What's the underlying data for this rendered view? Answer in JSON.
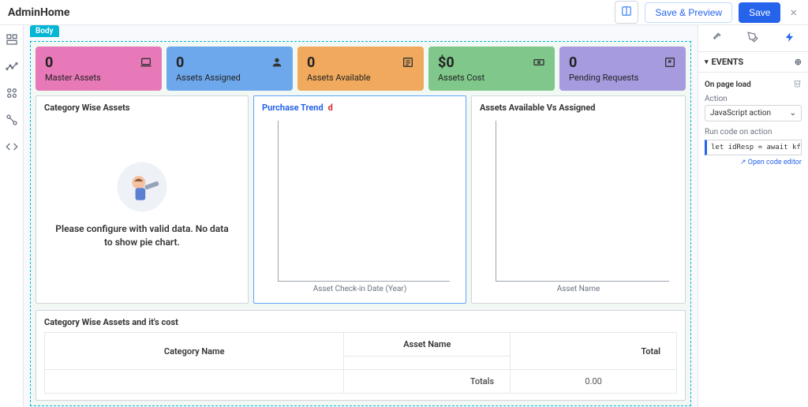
{
  "header": {
    "title": "AdminHome",
    "save_preview": "Save & Preview",
    "save": "Save"
  },
  "canvas": {
    "body_tag": "Body",
    "stats": [
      {
        "value": "0",
        "label": "Master Assets",
        "color": "c-pink",
        "icon": "laptop"
      },
      {
        "value": "0",
        "label": "Assets Assigned",
        "color": "c-blue",
        "icon": "user"
      },
      {
        "value": "0",
        "label": "Assets Available",
        "color": "c-orange",
        "icon": "list"
      },
      {
        "value": "$0",
        "label": "Assets Cost",
        "color": "c-green",
        "icon": "money"
      },
      {
        "value": "0",
        "label": "Pending Requests",
        "color": "c-purple",
        "icon": "open"
      }
    ],
    "panel_cat": {
      "title": "Category Wise Assets",
      "empty": "Please configure with valid data. No data to show pie chart."
    },
    "panel_trend": {
      "title": "Purchase Trend",
      "cursor": "d",
      "axis": "Asset Check-in Date (Year)"
    },
    "panel_avail": {
      "title": "Assets Available Vs Assigned",
      "axis": "Asset Name"
    },
    "cost_panel": {
      "title": "Category Wise Assets and it's cost",
      "col_asset": "Asset Name",
      "col_category": "Category Name",
      "col_total": "Total",
      "row_totals": "Totals",
      "total_value": "0.00"
    }
  },
  "right": {
    "section": "EVENTS",
    "event_name": "On page load",
    "action_label": "Action",
    "action_value": "JavaScript action",
    "code_label": "Run code on action",
    "code_snippet": "let idResp = await kf.api(\"/id\"",
    "code_link": "Open code editor"
  }
}
